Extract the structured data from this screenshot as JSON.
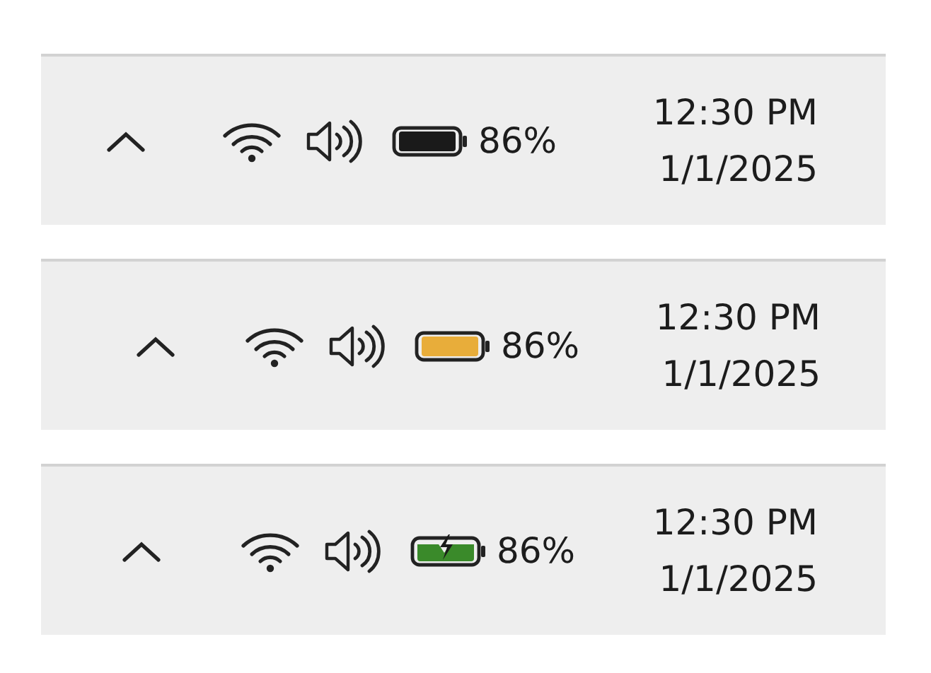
{
  "trays": [
    {
      "battery": {
        "kind": "normal",
        "percent": "86%"
      },
      "time": "12:30 PM",
      "date": "1/1/2025"
    },
    {
      "battery": {
        "kind": "saver",
        "percent": "86%"
      },
      "time": "12:30 PM",
      "date": "1/1/2025"
    },
    {
      "battery": {
        "kind": "charging",
        "percent": "86%"
      },
      "time": "12:30 PM",
      "date": "1/1/2025"
    }
  ]
}
